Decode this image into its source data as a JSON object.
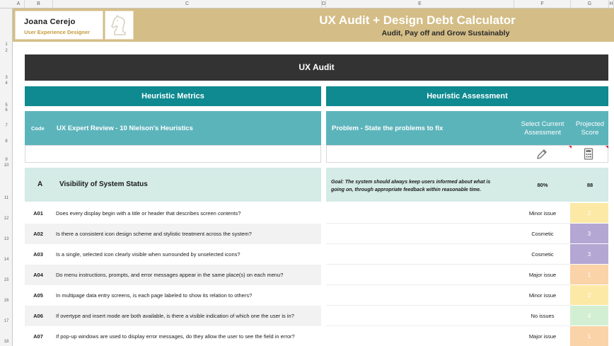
{
  "sheet": {
    "columns": [
      "A",
      "B",
      "C",
      "D",
      "E",
      "F",
      "G",
      "H"
    ],
    "rows": [
      "1",
      "2",
      "3",
      "4",
      "5",
      "6",
      "7",
      "8",
      "9",
      "10",
      "11",
      "12",
      "13",
      "14",
      "15",
      "16",
      "17",
      "18"
    ]
  },
  "header": {
    "name": "Joana Cerejo",
    "role": "User Experience Designer",
    "title": "UX Audit + Design Debt Calculator",
    "subtitle": "Audit, Pay off and Grow Sustainably"
  },
  "audit_title": "UX Audit",
  "metrics_title": "Heuristic Metrics",
  "assessment_title": "Heuristic Assessment",
  "columns": {
    "code": "Code",
    "review": "UX Expert Review - 10 Nielson's Heuristics",
    "problem": "Problem - State the problems to fix",
    "select_line1": "Select Current",
    "select_line2": "Assessment",
    "projected_line1": "Projected",
    "projected_line2": "Score"
  },
  "icons": {
    "assessment": "pencil-icon",
    "score": "calculator-icon"
  },
  "section": {
    "code": "A",
    "title": "Visibility of System Status",
    "goal_line1": "Goal: The system should always keep users informed about what is",
    "goal_line2": "going on, through appropriate feedback within reasonable time.",
    "percent": "80%",
    "score": "88"
  },
  "rows": [
    {
      "code": "A01",
      "question": "Does every display begin with a title or header that describes screen contents?",
      "assessment": "Minor issue",
      "score": "2",
      "color": "#fde9a6"
    },
    {
      "code": "A02",
      "question": "Is there a consistent icon design scheme and stylistic treatment across the system?",
      "assessment": "Cosmetic",
      "score": "3",
      "color": "#b4a7d3"
    },
    {
      "code": "A03",
      "question": "Is a single, selected icon clearly visible when surrounded by unselected icons?",
      "assessment": "Cosmetic",
      "score": "3",
      "color": "#b4a7d3"
    },
    {
      "code": "A04",
      "question": "Do menu instructions, prompts, and error messages appear in the same place(s) on each menu?",
      "assessment": "Major issue",
      "score": "1",
      "color": "#fbd3a8"
    },
    {
      "code": "A05",
      "question": "In multipage data entry screens, is each page labeled to show its relation to others?",
      "assessment": "Minor issue",
      "score": "2",
      "color": "#fde9a6"
    },
    {
      "code": "A06",
      "question": "If overtype and insert mode are both available, is there a visible indication of which one the user is in?",
      "assessment": "No issues",
      "score": "4",
      "color": "#d3efd3"
    },
    {
      "code": "A07",
      "question": "If pop-up windows are used to display error messages, do they allow the user to see the field in error?",
      "assessment": "Major issue",
      "score": "1",
      "color": "#fbd3a8"
    }
  ]
}
